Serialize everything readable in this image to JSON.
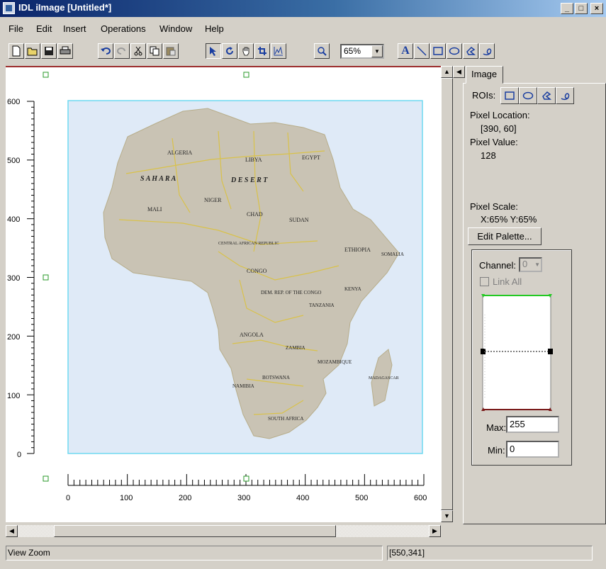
{
  "window": {
    "title": "IDL iImage [Untitled*]",
    "minimize": "_",
    "maximize": "□",
    "close": "×"
  },
  "menu": [
    "File",
    "Edit",
    "Insert",
    "Operations",
    "Window",
    "Help"
  ],
  "toolbar": {
    "zoom_value": "65%",
    "text_tool_label": "A"
  },
  "ruler": {
    "y_ticks": [
      "600",
      "500",
      "400",
      "300",
      "200",
      "100",
      "0"
    ],
    "x_ticks": [
      "0",
      "100",
      "200",
      "300",
      "400",
      "500",
      "600"
    ]
  },
  "map": {
    "labels": [
      "ALGERIA",
      "LIBYA",
      "EGYPT",
      "S A H A R A",
      "D E S E R T",
      "MALI",
      "NIGER",
      "CHAD",
      "SUDAN",
      "ETHIOPIA",
      "SOMALIA",
      "CONGO",
      "DEM. REP. OF THE CONGO",
      "KENYA",
      "TANZANIA",
      "ANGOLA",
      "ZAMBIA",
      "NAMIBIA",
      "BOTSWANA",
      "MOZAMBIQUE",
      "SOUTH AFRICA",
      "MADAGASCAR",
      "CENTRAL AFRICAN REPUBLIC"
    ],
    "ocean_color": "#dfeaf7",
    "land_color": "#c9c3b4",
    "frame_color": "#6fd9f0"
  },
  "panel": {
    "tab": "Image",
    "rois_label": "ROIs:",
    "pixel_location_label": "Pixel Location:",
    "pixel_location_value": "[390, 60]",
    "pixel_value_label": "Pixel Value:",
    "pixel_value_value": "128",
    "pixel_scale_label": "Pixel Scale:",
    "pixel_scale_value": "X:65%  Y:65%",
    "edit_palette": "Edit Palette...",
    "channel_label": "Channel:",
    "channel_value": "0",
    "link_all": "Link All",
    "max_label": "Max:",
    "max_value": "255",
    "min_label": "Min:",
    "min_value": "0"
  },
  "status": {
    "left": "View Zoom",
    "right": "[550,341]"
  }
}
